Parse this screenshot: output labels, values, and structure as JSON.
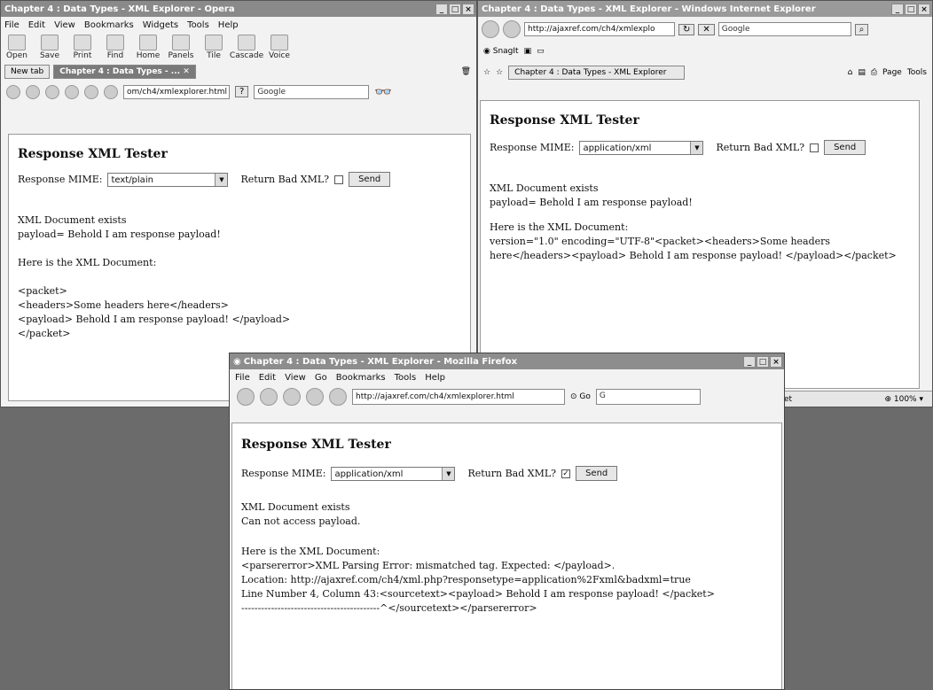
{
  "opera": {
    "title": "Chapter 4 : Data Types - XML Explorer - Opera",
    "menu": [
      "File",
      "Edit",
      "View",
      "Bookmarks",
      "Widgets",
      "Tools",
      "Help"
    ],
    "toolbar": [
      "Open",
      "Save",
      "Print",
      "Find",
      "Home",
      "Panels",
      "Tile",
      "Cascade",
      "Voice"
    ],
    "tabs": [
      "New tab",
      "Chapter 4 : Data Types - ..."
    ],
    "address": "om/ch4/xmlexplorer.html",
    "search": "Google",
    "page": {
      "heading": "Response XML Tester",
      "mime_label": "Response MIME:",
      "mime_value": "text/plain",
      "bad_label": "Return Bad XML?",
      "send": "Send",
      "out1": "XML Document exists",
      "out2": "payload= Behold I am response payload!",
      "out3": "Here is the XML Document:",
      "xml1": "<packet>",
      "xml2": "<headers>Some headers here</headers>",
      "xml3": "<payload> Behold I am response payload! </payload>",
      "xml4": "</packet>"
    }
  },
  "ie": {
    "title": "Chapter 4 : Data Types - XML Explorer - Windows Internet Explorer",
    "address": "http://ajaxref.com/ch4/xmlexplo",
    "search": "Google",
    "snagit": "SnagIt",
    "tab": "Chapter 4 : Data Types - XML Explorer",
    "page_menu": "Page",
    "tools_menu": "Tools",
    "status_text": "et",
    "zoom": "100%",
    "page": {
      "heading": "Response XML Tester",
      "mime_label": "Response MIME:",
      "mime_value": "application/xml",
      "bad_label": "Return Bad XML?",
      "send": "Send",
      "out1": "XML Document exists",
      "out2": "payload= Behold I am response payload!",
      "out3": "Here is the XML Document:",
      "xml1": "version=\"1.0\" encoding=\"UTF-8\"<packet><headers>Some headers",
      "xml2": "here</headers><payload> Behold I am response payload! </payload></packet>"
    }
  },
  "firefox": {
    "title": "Chapter 4 : Data Types - XML Explorer - Mozilla Firefox",
    "menu": [
      "File",
      "Edit",
      "View",
      "Go",
      "Bookmarks",
      "Tools",
      "Help"
    ],
    "address": "http://ajaxref.com/ch4/xmlexplorer.html",
    "go": "Go",
    "search": "G",
    "page": {
      "heading": "Response XML Tester",
      "mime_label": "Response MIME:",
      "mime_value": "application/xml",
      "bad_label": "Return Bad XML?",
      "send": "Send",
      "out1": "XML Document exists",
      "out2": "Can not access payload.",
      "out3": "Here is the XML Document:",
      "err1": "<parsererror>XML Parsing Error: mismatched tag. Expected: </payload>.",
      "err2": "Location: http://ajaxref.com/ch4/xml.php?responsetype=application%2Fxml&badxml=true",
      "err3": "Line Number 4, Column 43:<sourcetext><payload> Behold I am response payload! </packet>",
      "err4": "------------------------------------------^</sourcetext></parsererror>"
    }
  }
}
